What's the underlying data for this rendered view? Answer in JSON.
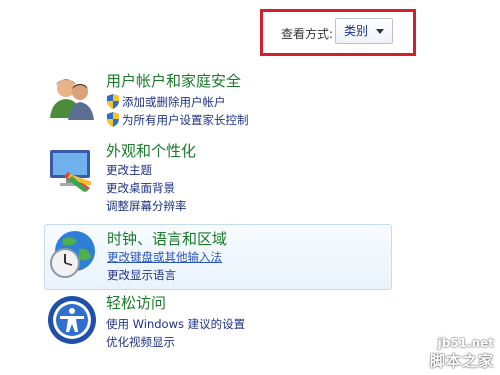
{
  "view_by": {
    "label": "查看方式:",
    "selected": "类别"
  },
  "categories": [
    {
      "title": "用户帐户和家庭安全",
      "links": [
        "添加或删除用户帐户",
        "为所有用户设置家长控制"
      ]
    },
    {
      "title": "外观和个性化",
      "links": [
        "更改主题",
        "更改桌面背景",
        "调整屏幕分辨率"
      ]
    },
    {
      "title": "时钟、语言和区域",
      "links": [
        "更改键盘或其他输入法",
        "更改显示语言"
      ]
    },
    {
      "title": "轻松访问",
      "links": [
        "使用 Windows 建议的设置",
        "优化视频显示"
      ]
    }
  ],
  "watermark": {
    "site": "jb51.net",
    "name": "脚本之家"
  },
  "colors": {
    "highlight_border": "#d2202f",
    "category_title": "#1a7a2a",
    "link": "#1e3287"
  }
}
